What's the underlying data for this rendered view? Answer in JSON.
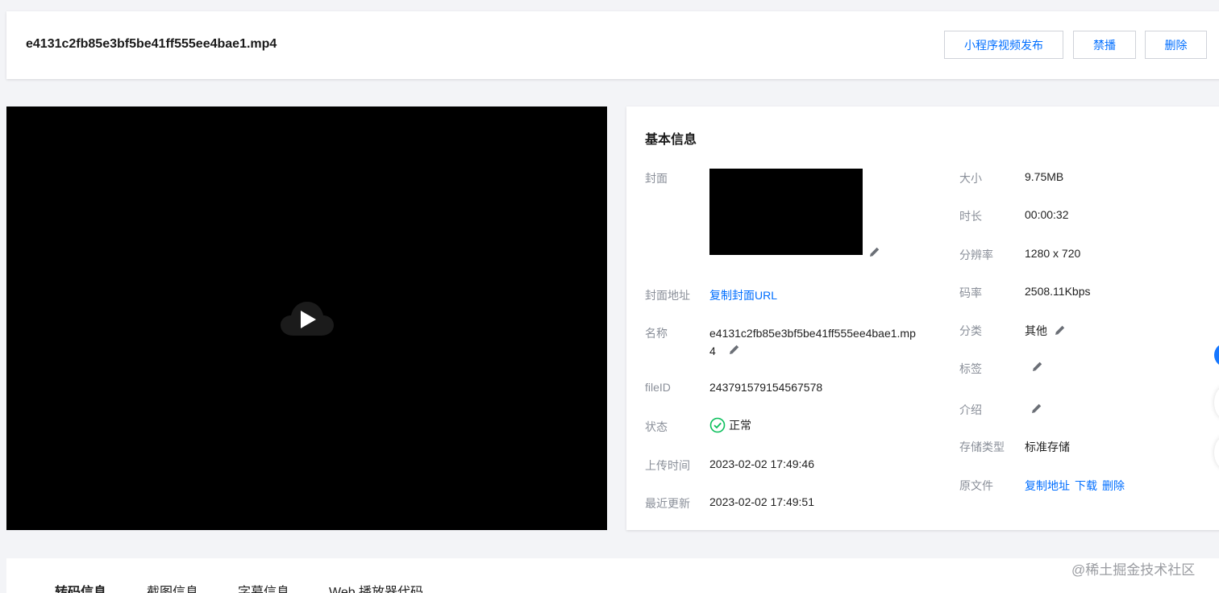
{
  "header": {
    "file_title": "e4131c2fb85e3bf5be41ff555ee4bae1.mp4",
    "buttons": {
      "publish": "小程序视频发布",
      "ban": "禁播",
      "delete": "删除"
    }
  },
  "info": {
    "title": "基本信息",
    "left": {
      "cover_label": "封面",
      "cover_url_label": "封面地址",
      "cover_url_link": "复制封面URL",
      "name_label": "名称",
      "name_value": "e4131c2fb85e3bf5be41ff555ee4bae1.mp4",
      "fileid_label": "fileID",
      "fileid_value": "243791579154567578",
      "status_label": "状态",
      "status_value": "正常",
      "upload_label": "上传时间",
      "upload_value": "2023-02-02 17:49:46",
      "update_label": "最近更新",
      "update_value": "2023-02-02 17:49:51"
    },
    "right": {
      "size_label": "大小",
      "size_value": "9.75MB",
      "duration_label": "时长",
      "duration_value": "00:00:32",
      "resolution_label": "分辨率",
      "resolution_value": "1280 x 720",
      "bitrate_label": "码率",
      "bitrate_value": "2508.11Kbps",
      "category_label": "分类",
      "category_value": "其他",
      "tags_label": "标签",
      "intro_label": "介绍",
      "storage_label": "存储类型",
      "storage_value": "标准存储",
      "source_label": "原文件",
      "source_copy": "复制地址",
      "source_download": "下载",
      "source_delete": "删除"
    }
  },
  "tabs": [
    "转码信息",
    "截图信息",
    "字幕信息",
    "Web 播放器代码"
  ],
  "watermark": "@稀土掘金技术社区",
  "colors": {
    "accent": "#006eff",
    "status_ok": "#0abf5b",
    "label": "#8a8f99",
    "page_bg": "#f3f4f7"
  },
  "icons": {
    "play": "play-icon",
    "edit": "pencil-icon",
    "status": "check-circle-icon"
  }
}
